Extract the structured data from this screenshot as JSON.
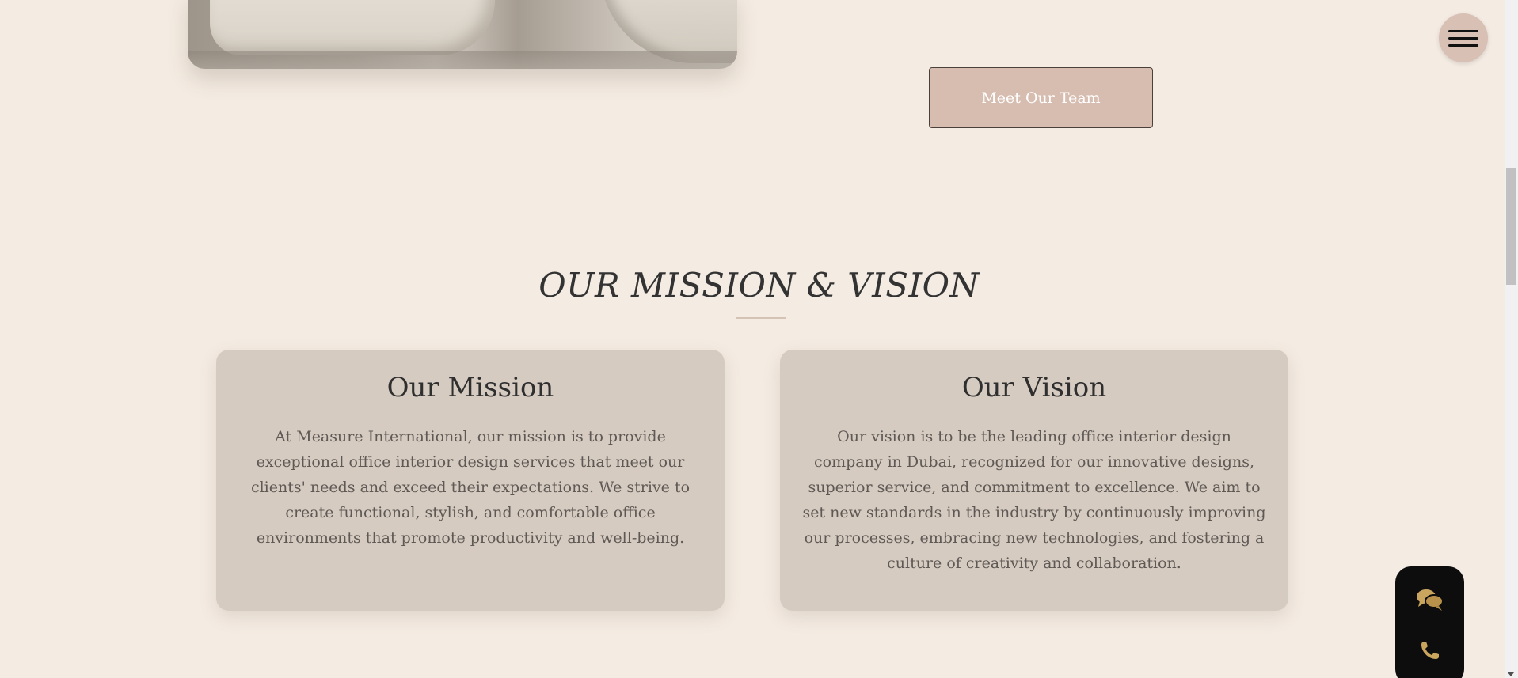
{
  "hero": {
    "image_alt": "office interior with white lounge chairs"
  },
  "team_button": {
    "label": "Meet Our Team"
  },
  "menu": {
    "icon": "hamburger-menu-icon"
  },
  "section": {
    "title": "OUR MISSION & VISION"
  },
  "cards": [
    {
      "title": "Our Mission",
      "body": "At Measure International, our mission is to provide exceptional office interior design services that meet our clients' needs and exceed their expectations. We strive to create functional, stylish, and comfortable office environments that promote productivity and well-being."
    },
    {
      "title": "Our Vision",
      "body": "Our vision is to be the leading office interior design company in Dubai, recognized for our innovative designs, superior service, and commitment to excellence. We aim to set new standards in the industry by continuously improving our processes, embracing new technologies, and fostering a culture of creativity and collaboration."
    }
  ],
  "contact_widget": {
    "icons": [
      "chat-bubbles-icon",
      "phone-icon"
    ]
  },
  "colors": {
    "background": "#f4ebe2",
    "accent": "#d7bcb0",
    "card": "#d6cbc1",
    "gold": "#c9a55e"
  }
}
